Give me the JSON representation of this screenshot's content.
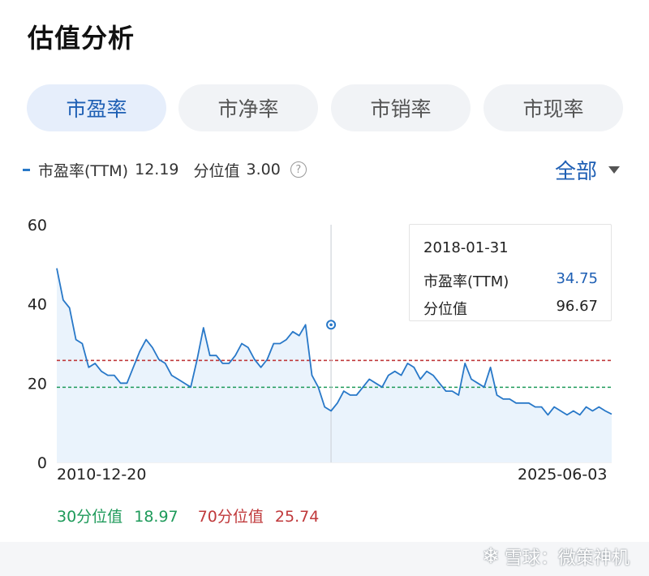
{
  "page": {
    "title": "估值分析"
  },
  "tabs": [
    {
      "label": "市盈率",
      "active": true
    },
    {
      "label": "市净率",
      "active": false
    },
    {
      "label": "市销率",
      "active": false
    },
    {
      "label": "市现率",
      "active": false
    }
  ],
  "legend": {
    "metric_label": "市盈率(TTM)",
    "metric_value": "12.19",
    "percentile_label": "分位值",
    "percentile_value": "3.00",
    "help_icon": "?"
  },
  "range_select": {
    "label": "全部"
  },
  "tooltip": {
    "date": "2018-01-31",
    "metric_label": "市盈率(TTM)",
    "metric_value": "34.75",
    "percentile_label": "分位值",
    "percentile_value": "96.67"
  },
  "percentiles": {
    "p30_label": "30分位值",
    "p30_value": "18.97",
    "p70_label": "70分位值",
    "p70_value": "25.74"
  },
  "watermark": {
    "text": "雪球：微策神机"
  },
  "colors": {
    "line": "#2878c8",
    "area": "#eaf3fc",
    "p30": "#1e9a5a",
    "p70": "#c0393b",
    "accent": "#1e5fb4"
  },
  "chart_data": {
    "type": "area",
    "series": [
      {
        "name": "市盈率(TTM)",
        "x": [
          "2010-12-20",
          "2011-01-31",
          "2011-03-31",
          "2011-05-31",
          "2011-07-31",
          "2011-09-30",
          "2011-11-30",
          "2012-01-31",
          "2012-03-31",
          "2012-05-31",
          "2012-07-31",
          "2012-09-30",
          "2012-11-30",
          "2013-01-31",
          "2013-03-31",
          "2013-05-31",
          "2013-07-31",
          "2013-09-30",
          "2013-11-30",
          "2014-01-31",
          "2014-03-31",
          "2014-05-31",
          "2014-07-31",
          "2014-09-30",
          "2014-11-30",
          "2015-01-31",
          "2015-03-31",
          "2015-05-31",
          "2015-07-31",
          "2015-09-30",
          "2015-11-30",
          "2016-01-31",
          "2016-03-31",
          "2016-05-31",
          "2016-07-31",
          "2016-09-30",
          "2016-11-30",
          "2017-01-31",
          "2017-03-31",
          "2017-05-31",
          "2017-07-31",
          "2017-09-30",
          "2017-11-30",
          "2018-01-31",
          "2018-03-31",
          "2018-05-31",
          "2018-07-31",
          "2018-09-30",
          "2018-11-30",
          "2019-01-31",
          "2019-03-31",
          "2019-05-31",
          "2019-07-31",
          "2019-09-30",
          "2019-11-30",
          "2020-01-31",
          "2020-03-31",
          "2020-05-31",
          "2020-07-31",
          "2020-09-30",
          "2020-11-30",
          "2021-01-31",
          "2021-03-31",
          "2021-05-31",
          "2021-07-31",
          "2021-09-30",
          "2021-11-30",
          "2022-01-31",
          "2022-03-31",
          "2022-05-31",
          "2022-07-31",
          "2022-09-30",
          "2022-11-30",
          "2023-01-31",
          "2023-03-31",
          "2023-05-31",
          "2023-07-31",
          "2023-09-30",
          "2023-11-30",
          "2024-01-31",
          "2024-03-31",
          "2024-05-31",
          "2024-07-31",
          "2024-09-30",
          "2024-11-30",
          "2025-01-31",
          "2025-03-31",
          "2025-06-03"
        ],
        "values": [
          49,
          41,
          39,
          31,
          30,
          24,
          25,
          23,
          22,
          22,
          20,
          20,
          24,
          28,
          31,
          29,
          26,
          25,
          22,
          21,
          20,
          19,
          26,
          34,
          27,
          27,
          25,
          25,
          27,
          30,
          29,
          26,
          24,
          26,
          30,
          30,
          31,
          33,
          32,
          34.75,
          22,
          19,
          14,
          13,
          15,
          18,
          17,
          17,
          19,
          21,
          20,
          19,
          22,
          23,
          22,
          25,
          24,
          21,
          23,
          22,
          20,
          18,
          18,
          17,
          25,
          21,
          20,
          19,
          24,
          17,
          16,
          16,
          15,
          15,
          15,
          14,
          14,
          12,
          14,
          13,
          12,
          13,
          12,
          14,
          13,
          14,
          13,
          12.19
        ]
      }
    ],
    "xlabel": "",
    "ylabel": "",
    "ylim": [
      0,
      60
    ],
    "yticks": [
      "0",
      "20",
      "40",
      "60"
    ],
    "x_tick_labels": [
      "2010-12-20",
      "2025-06-03"
    ],
    "reference_lines": [
      {
        "name": "30分位值",
        "value": 18.97
      },
      {
        "name": "70分位值",
        "value": 25.74
      }
    ],
    "highlight": {
      "x": "2018-01-31",
      "value": 34.75
    },
    "grid": false,
    "legend_position": "top-left"
  }
}
